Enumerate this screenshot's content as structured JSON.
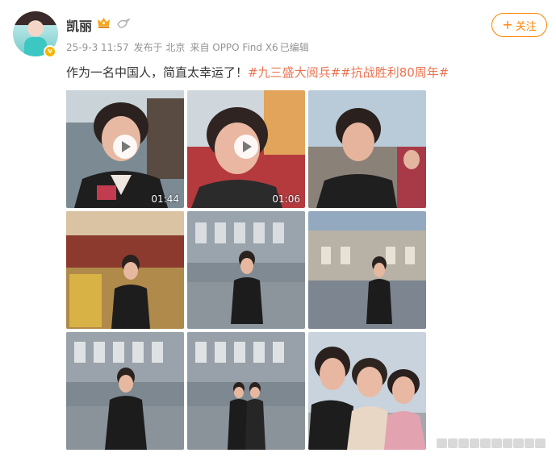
{
  "user": {
    "name": "凯丽",
    "avatar_icon": "avatar-image",
    "badge_icon": "verified-badge-icon"
  },
  "post": {
    "meta": {
      "date": "25-9-3 11:57",
      "location": "发布于 北京",
      "source": "来自 OPPO Find X6",
      "edited": "已编辑"
    },
    "text": "作为一名中国人，简直太幸运了！",
    "hashtags": [
      "#九三盛大阅兵#",
      "#抗战胜利80周年#"
    ]
  },
  "follow_button": {
    "label": "关注",
    "icon": "plus-icon"
  },
  "media": [
    {
      "type": "video",
      "duration": "01:44",
      "scene": "selfie-stands"
    },
    {
      "type": "video",
      "duration": "01:06",
      "scene": "selfie-square"
    },
    {
      "type": "photo",
      "scene": "selfie-crowd"
    },
    {
      "type": "photo",
      "scene": "gate-red"
    },
    {
      "type": "photo",
      "scene": "hall-front"
    },
    {
      "type": "photo",
      "scene": "hall-side"
    },
    {
      "type": "photo",
      "scene": "hall-front-2"
    },
    {
      "type": "photo",
      "scene": "hall-two-people"
    },
    {
      "type": "photo",
      "scene": "three-ladies"
    }
  ],
  "colors": {
    "accent": "#ff8200",
    "hashtag": "#eb7350",
    "meta": "#939393",
    "text": "#333333"
  }
}
